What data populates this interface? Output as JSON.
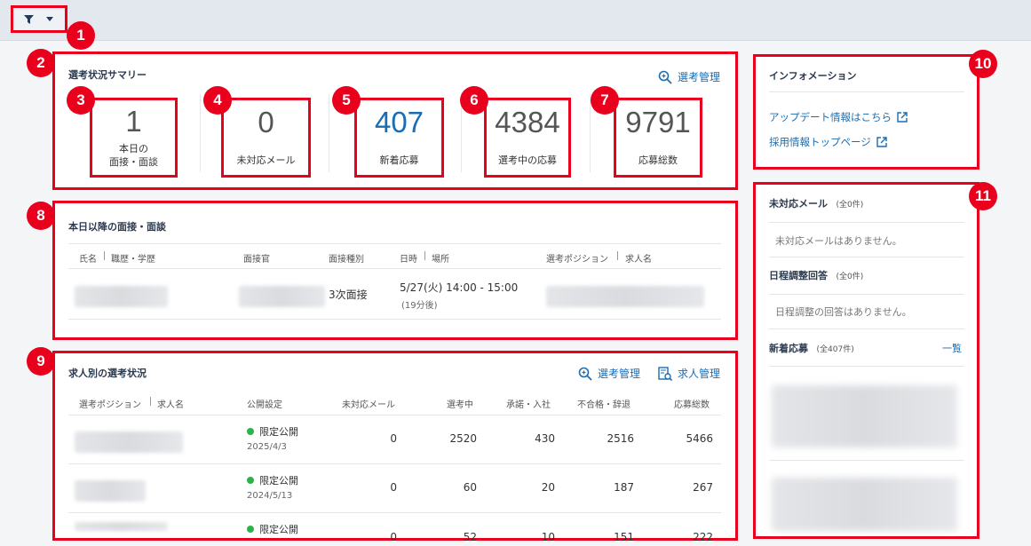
{
  "callouts": [
    "1",
    "2",
    "3",
    "4",
    "5",
    "6",
    "7",
    "8",
    "9",
    "10",
    "11"
  ],
  "summary": {
    "title": "選考状況サマリー",
    "manage_link": "選考管理",
    "stats": [
      {
        "value": "1",
        "label_line1": "本日の",
        "label_line2": "面接・面談",
        "color": "#555555"
      },
      {
        "value": "0",
        "label_line1": "未対応メール",
        "label_line2": "",
        "color": "#555555"
      },
      {
        "value": "407",
        "label_line1": "新着応募",
        "label_line2": "",
        "color": "#1a6db3"
      },
      {
        "value": "4384",
        "label_line1": "選考中の応募",
        "label_line2": "",
        "color": "#555555"
      },
      {
        "value": "9791",
        "label_line1": "応募総数",
        "label_line2": "",
        "color": "#555555"
      }
    ]
  },
  "interviews": {
    "title": "本日以降の面接・面談",
    "headers": {
      "name": "氏名",
      "career": "職歴・学歴",
      "interviewer": "面接官",
      "type": "面接種別",
      "datetime": "日時",
      "place": "場所",
      "position": "選考ポジション",
      "job": "求人名"
    },
    "row": {
      "type": "3次面接",
      "datetime": "5/27(火) 14:00 - 15:00",
      "relative": "(19分後)"
    }
  },
  "jobs": {
    "title": "求人別の選考状況",
    "manage_link": "選考管理",
    "job_link": "求人管理",
    "headers": {
      "position": "選考ポジション",
      "job": "求人名",
      "pub": "公開設定",
      "unread": "未対応メール",
      "active": "選考中",
      "accepted": "承諾・入社",
      "rejected": "不合格・辞退",
      "total": "応募総数"
    },
    "rows": [
      {
        "pub": "限定公開",
        "date": "2025/4/3",
        "unread": "0",
        "active": "2520",
        "accepted": "430",
        "rejected": "2516",
        "total": "5466"
      },
      {
        "pub": "限定公開",
        "date": "2024/5/13",
        "unread": "0",
        "active": "60",
        "accepted": "20",
        "rejected": "187",
        "total": "267"
      },
      {
        "pub": "限定公開",
        "date": "",
        "unread": "0",
        "active": "52",
        "accepted": "10",
        "rejected": "151",
        "total": "222"
      }
    ]
  },
  "info": {
    "title": "インフォメーション",
    "links": [
      "アップデート情報はこちら",
      "採用情報トップページ"
    ]
  },
  "side": {
    "mail_title": "未対応メール",
    "mail_count": "(全0件)",
    "mail_empty": "未対応メールはありません。",
    "sched_title": "日程調整回答",
    "sched_count": "(全0件)",
    "sched_empty": "日程調整の回答はありません。",
    "new_title": "新着応募",
    "new_count": "(全407件)",
    "new_link": "一覧"
  }
}
